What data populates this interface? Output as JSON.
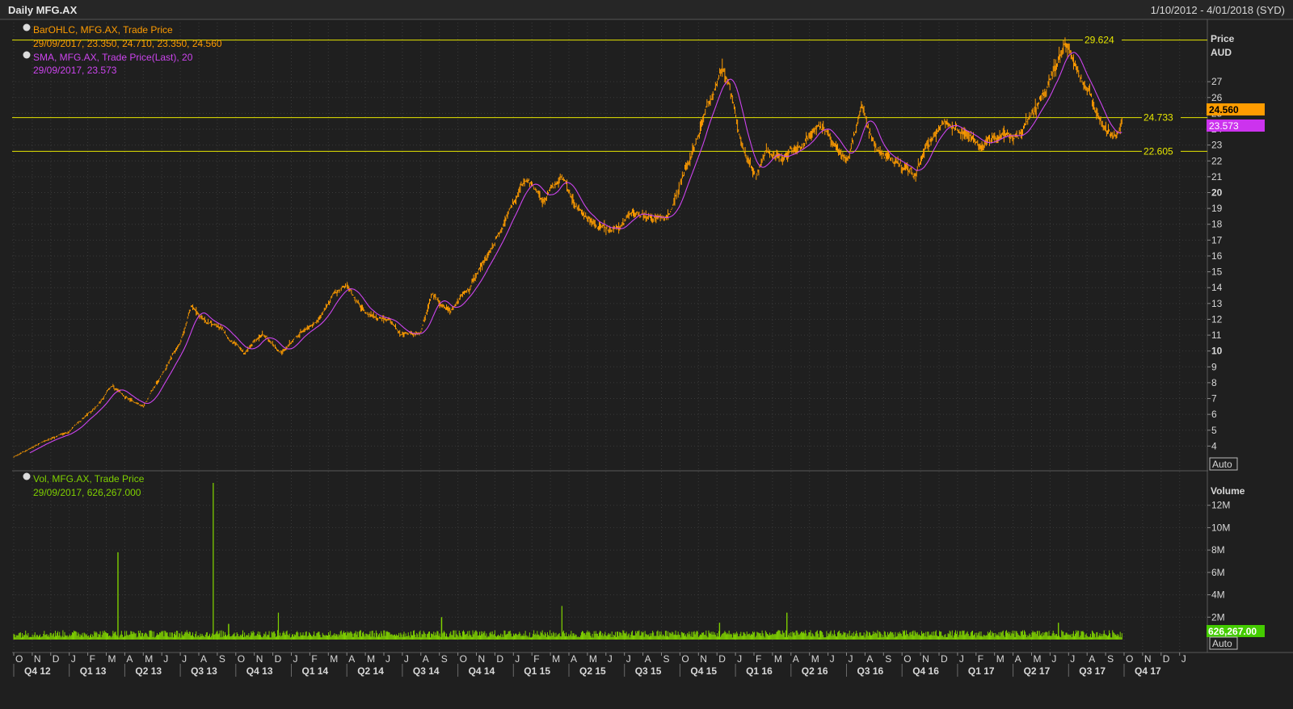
{
  "header": {
    "title": "Daily MFG.AX",
    "date_range": "1/10/2012 - 4/01/2018 (SYD)"
  },
  "colors": {
    "background": "#1f1f1f",
    "grid": "#3a3a3a",
    "price": "#ff9c00",
    "sma": "#cc44ee",
    "volume": "#7fd000",
    "hline": "#e6e600",
    "axis_text": "#d8d8d8"
  },
  "price_panel": {
    "legend": [
      {
        "line1": "BarOHLC, MFG.AX, Trade Price",
        "line2": "29/09/2017, 23.350, 24.710, 23.350, 24.560",
        "color": "#ff9c00"
      },
      {
        "line1": "SMA, MFG.AX, Trade Price(Last),  20",
        "line2": "29/09/2017, 23.573",
        "color": "#cc44ee"
      }
    ],
    "axis_title": "Price",
    "axis_unit": "AUD",
    "last_price_label": "24.560",
    "sma_label": "23.573",
    "auto_button": "Auto",
    "hlines": [
      {
        "value": 29.624,
        "label": "29.624"
      },
      {
        "value": 24.733,
        "label": "24.733"
      },
      {
        "value": 22.605,
        "label": "22.605"
      }
    ]
  },
  "volume_panel": {
    "legend_line1": "Vol, MFG.AX, Trade Price",
    "legend_line2": "29/09/2017, 626,267.000",
    "axis_title": "Volume",
    "last_volume_label": "626,267.00",
    "auto_button": "Auto"
  },
  "chart_data": [
    {
      "type": "line",
      "title": "Daily MFG.AX",
      "ylabel": "Price AUD",
      "ylim": [
        3,
        30.5
      ],
      "y_ticks": [
        "4",
        "5",
        "6",
        "7",
        "8",
        "9",
        "10",
        "11",
        "12",
        "13",
        "14",
        "15",
        "16",
        "17",
        "18",
        "19",
        "20",
        "21",
        "22",
        "23",
        "24",
        "25",
        "26",
        "27"
      ],
      "x_month_labels": [
        "O",
        "N",
        "D",
        "J",
        "F",
        "M",
        "A",
        "M",
        "J",
        "J",
        "A",
        "S",
        "O",
        "N",
        "D",
        "J",
        "F",
        "M",
        "A",
        "M",
        "J",
        "J",
        "A",
        "S",
        "O",
        "N",
        "D",
        "J",
        "F",
        "M",
        "A",
        "M",
        "J",
        "J",
        "A",
        "S",
        "O",
        "N",
        "D",
        "J",
        "F",
        "M",
        "A",
        "M",
        "J",
        "J",
        "A",
        "S",
        "O",
        "N",
        "D",
        "J",
        "F",
        "M",
        "A",
        "M",
        "J",
        "J",
        "A",
        "S",
        "O",
        "N",
        "D",
        "J"
      ],
      "x_quarter_labels": [
        "Q4 12",
        "Q1 13",
        "Q2 13",
        "Q3 13",
        "Q4 13",
        "Q1 14",
        "Q2 14",
        "Q3 14",
        "Q4 14",
        "Q1 15",
        "Q2 15",
        "Q3 15",
        "Q4 15",
        "Q1 16",
        "Q2 16",
        "Q3 16",
        "Q4 16",
        "Q1 17",
        "Q2 17",
        "Q3 17",
        "Q4 17"
      ],
      "x_start_month": "2012-10",
      "series": [
        {
          "name": "BarOHLC, MFG.AX, Trade Price",
          "points": [
            [
              "2012-10-01",
              3.3
            ],
            [
              "2012-11-15",
              4.2
            ],
            [
              "2013-01-01",
              4.9
            ],
            [
              "2013-02-15",
              6.5
            ],
            [
              "2013-03-10",
              7.8
            ],
            [
              "2013-04-01",
              7.0
            ],
            [
              "2013-05-01",
              6.5
            ],
            [
              "2013-06-01",
              8.5
            ],
            [
              "2013-07-01",
              10.5
            ],
            [
              "2013-07-20",
              12.8
            ],
            [
              "2013-08-15",
              11.8
            ],
            [
              "2013-09-10",
              11.3
            ],
            [
              "2013-10-15",
              9.8
            ],
            [
              "2013-11-15",
              11.0
            ],
            [
              "2013-12-15",
              10.0
            ],
            [
              "2014-01-15",
              11.0
            ],
            [
              "2014-02-15",
              12.0
            ],
            [
              "2014-03-10",
              13.5
            ],
            [
              "2014-04-01",
              14.0
            ],
            [
              "2014-05-01",
              12.5
            ],
            [
              "2014-06-01",
              12.0
            ],
            [
              "2014-07-01",
              11.0
            ],
            [
              "2014-08-01",
              11.0
            ],
            [
              "2014-08-20",
              13.5
            ],
            [
              "2014-09-20",
              12.5
            ],
            [
              "2014-10-20",
              14.0
            ],
            [
              "2014-11-20",
              16.0
            ],
            [
              "2014-12-20",
              18.5
            ],
            [
              "2015-01-20",
              20.5
            ],
            [
              "2015-02-20",
              19.5
            ],
            [
              "2015-03-20",
              21.0
            ],
            [
              "2015-04-15",
              19.0
            ],
            [
              "2015-05-15",
              18.0
            ],
            [
              "2015-06-15",
              17.5
            ],
            [
              "2015-07-15",
              18.5
            ],
            [
              "2015-08-15",
              18.5
            ],
            [
              "2015-09-15",
              19.0
            ],
            [
              "2015-10-15",
              22.0
            ],
            [
              "2015-11-15",
              25.5
            ],
            [
              "2015-12-10",
              27.5
            ],
            [
              "2015-12-20",
              26.5
            ],
            [
              "2016-01-10",
              23.5
            ],
            [
              "2016-02-05",
              21.0
            ],
            [
              "2016-02-20",
              22.5
            ],
            [
              "2016-03-15",
              22.0
            ],
            [
              "2016-04-15",
              23.0
            ],
            [
              "2016-05-15",
              24.0
            ],
            [
              "2016-06-10",
              23.0
            ],
            [
              "2016-07-01",
              21.5
            ],
            [
              "2016-07-25",
              25.0
            ],
            [
              "2016-08-20",
              23.0
            ],
            [
              "2016-09-20",
              22.0
            ],
            [
              "2016-10-20",
              21.0
            ],
            [
              "2016-11-10",
              23.0
            ],
            [
              "2016-12-10",
              24.5
            ],
            [
              "2017-01-10",
              24.0
            ],
            [
              "2017-02-10",
              23.5
            ],
            [
              "2017-03-10",
              23.5
            ],
            [
              "2017-04-10",
              23.5
            ],
            [
              "2017-05-10",
              25.5
            ],
            [
              "2017-06-10",
              28.0
            ],
            [
              "2017-06-25",
              29.6
            ],
            [
              "2017-07-20",
              27.5
            ],
            [
              "2017-08-10",
              26.0
            ],
            [
              "2017-08-25",
              24.5
            ],
            [
              "2017-09-15",
              23.2
            ],
            [
              "2017-09-29",
              24.56
            ]
          ]
        },
        {
          "name": "SMA, MFG.AX, Trade Price(Last),  20",
          "smoothed_from": "BarOHLC, MFG.AX, Trade Price"
        }
      ]
    },
    {
      "type": "bar",
      "title": "Vol, MFG.AX, Trade Price",
      "ylabel": "Volume",
      "ylim": [
        0,
        14000000
      ],
      "y_ticks": [
        "2M",
        "4M",
        "6M",
        "8M",
        "10M",
        "12M"
      ],
      "baseline_volume": 600000,
      "spikes": [
        [
          "2013-03-20",
          7800000
        ],
        [
          "2013-08-25",
          14000000
        ],
        [
          "2013-09-20",
          1400000
        ],
        [
          "2013-12-10",
          2400000
        ],
        [
          "2014-09-05",
          2000000
        ],
        [
          "2015-03-20",
          3000000
        ],
        [
          "2015-12-05",
          1500000
        ],
        [
          "2016-03-25",
          2400000
        ],
        [
          "2017-06-15",
          1500000
        ]
      ],
      "last": [
        "2017-09-29",
        626267
      ]
    }
  ]
}
